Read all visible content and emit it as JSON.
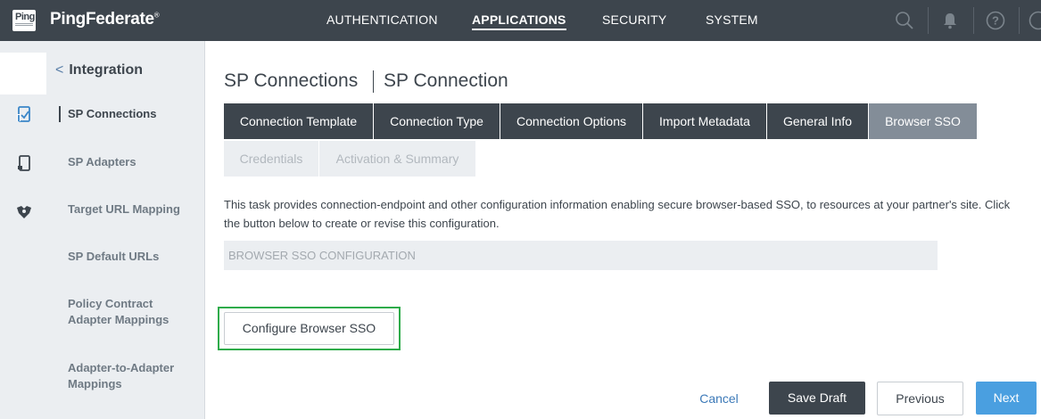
{
  "topbar": {
    "logo_text": "Ping",
    "brand": "PingFederate",
    "brand_mark": "®",
    "nav": [
      "AUTHENTICATION",
      "APPLICATIONS",
      "SECURITY",
      "SYSTEM"
    ],
    "active_nav": "APPLICATIONS",
    "icons": [
      "search-icon",
      "bell-icon",
      "help-icon",
      "user-icon"
    ]
  },
  "rail": {
    "icons": [
      "sp-connections-icon",
      "sp-adapters-icon",
      "target-url-icon"
    ]
  },
  "sidebar": {
    "back_label": "Integration",
    "items": [
      {
        "label": "SP Connections",
        "active": true
      },
      {
        "label": "SP Adapters"
      },
      {
        "label": "Target URL Mapping"
      },
      {
        "label": "SP Default URLs"
      },
      {
        "label": "Policy Contract Adapter Mappings"
      },
      {
        "label": "Adapter-to-Adapter Mappings"
      }
    ]
  },
  "breadcrumb": {
    "parent": "SP Connections",
    "current": "SP Connection"
  },
  "tabs": {
    "row1": [
      "Connection Template",
      "Connection Type",
      "Connection Options",
      "Import Metadata",
      "General Info",
      "Browser SSO"
    ],
    "row2": [
      "Credentials",
      "Activation & Summary"
    ],
    "current": "Browser SSO"
  },
  "content": {
    "description": "This task provides connection-endpoint and other configuration information enabling secure browser-based SSO, to resources at your partner's site. Click the button below to create or revise this configuration.",
    "section_title": "BROWSER SSO CONFIGURATION",
    "configure_button": "Configure Browser SSO"
  },
  "footer": {
    "cancel": "Cancel",
    "save_draft": "Save Draft",
    "previous": "Previous",
    "next": "Next"
  },
  "colors": {
    "topbar": "#3d454d",
    "current_tab": "#838d98",
    "next_button": "#4a9fe0",
    "highlight": "#2eab4a",
    "link": "#3d7ab8"
  }
}
